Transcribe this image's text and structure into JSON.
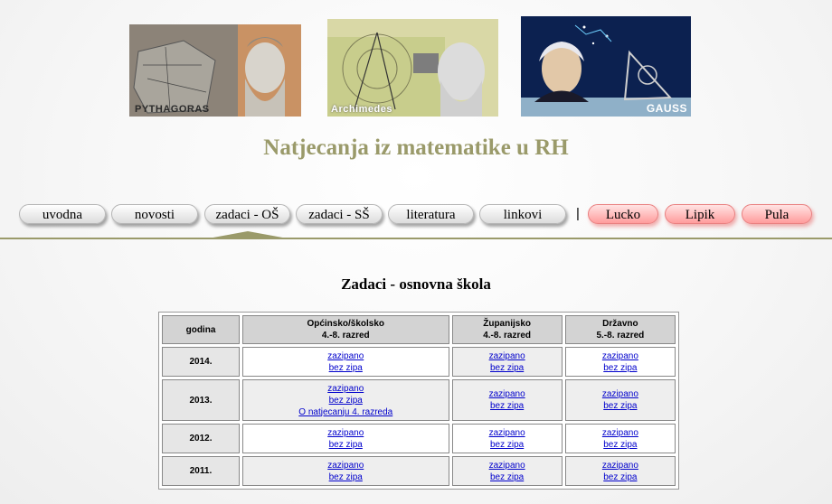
{
  "banner": {
    "captions": [
      "PYTHAGORAS",
      "Archimedes",
      "GAUSS"
    ]
  },
  "site_title": "Natjecanja iz matematike u RH",
  "nav": {
    "items": [
      "uvodna",
      "novosti",
      "zadaci - OŠ",
      "zadaci - SŠ",
      "literatura",
      "linkovi"
    ],
    "separator": "|",
    "red_items": [
      "Lucko",
      "Lipik",
      "Pula"
    ],
    "active": "zadaci - OŠ"
  },
  "page_heading": "Zadaci - osnovna škola",
  "table": {
    "headers": [
      {
        "line1": "godina",
        "line2": ""
      },
      {
        "line1": "Općinsko/školsko",
        "line2": "4.-8. razred"
      },
      {
        "line1": "Županijsko",
        "line2": "4.-8. razred"
      },
      {
        "line1": "Državno",
        "line2": "5.-8. razred"
      }
    ],
    "rows": [
      {
        "year": "2014.",
        "cols": [
          [
            "zazipano",
            "bez zipa"
          ],
          [
            "zazipano",
            "bez zipa"
          ],
          [
            "zazipano",
            "bez zipa"
          ]
        ]
      },
      {
        "year": "2013.",
        "cols": [
          [
            "zazipano",
            "bez zipa",
            "O natjecanju 4. razreda"
          ],
          [
            "zazipano",
            "bez zipa"
          ],
          [
            "zazipano",
            "bez zipa"
          ]
        ]
      },
      {
        "year": "2012.",
        "cols": [
          [
            "zazipano",
            "bez zipa"
          ],
          [
            "zazipano",
            "bez zipa"
          ],
          [
            "zazipano",
            "bez zipa"
          ]
        ]
      },
      {
        "year": "2011.",
        "cols": [
          [
            "zazipano",
            "bez zipa"
          ],
          [
            "zazipano",
            "bez zipa"
          ],
          [
            "zazipano",
            "bez zipa"
          ]
        ]
      }
    ]
  },
  "colors": {
    "accent": "#9a9a6a",
    "link": "#0000cc",
    "red_button": "#ff9c9c"
  }
}
